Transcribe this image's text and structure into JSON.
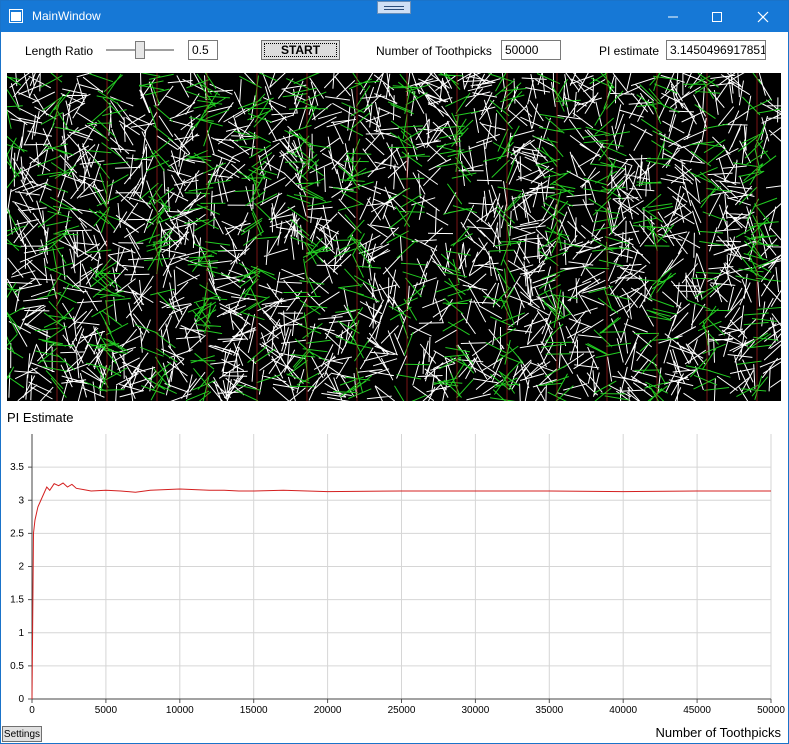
{
  "window": {
    "title": "MainWindow",
    "title_bar_color": "#1678d6"
  },
  "controls": {
    "length_ratio_label": "Length Ratio",
    "length_ratio_value": "0.5",
    "length_ratio_slider_fraction": 0.5,
    "start_label": "START",
    "toothpicks_label": "Number of Toothpicks",
    "toothpicks_value": "50000",
    "pi_label": "PI estimate",
    "pi_value": "3.14504969178513"
  },
  "simulation": {
    "background": "#000000",
    "crossing_color": "#22cc22",
    "non_crossing_color": "#ffffff",
    "line_color": "#cc2222"
  },
  "chart_title": "PI Estimate",
  "settings_label": "Settings",
  "chart_data": {
    "type": "line",
    "title": "PI Estimate",
    "xlabel": "Number of Toothpicks",
    "ylabel": "",
    "xlim": [
      0,
      50000
    ],
    "ylim": [
      0,
      4
    ],
    "xticks": [
      0,
      5000,
      10000,
      15000,
      20000,
      25000,
      30000,
      35000,
      40000,
      45000,
      50000
    ],
    "yticks": [
      0,
      0.5,
      1,
      1.5,
      2,
      2.5,
      3,
      3.5
    ],
    "grid": true,
    "series_color": "#d42020",
    "series": [
      {
        "x": [
          0,
          100,
          200,
          400,
          600,
          800,
          1000,
          1200,
          1500,
          1800,
          2100,
          2400,
          2700,
          3000,
          3500,
          4000,
          5000,
          6000,
          7000,
          8000,
          9000,
          10000,
          11000,
          12000,
          13000,
          14000,
          15000,
          17000,
          20000,
          25000,
          30000,
          35000,
          40000,
          45000,
          50000
        ],
        "y": [
          0,
          2.5,
          2.7,
          2.9,
          3.0,
          3.1,
          3.2,
          3.15,
          3.25,
          3.22,
          3.26,
          3.2,
          3.24,
          3.18,
          3.16,
          3.14,
          3.15,
          3.14,
          3.12,
          3.15,
          3.16,
          3.17,
          3.16,
          3.15,
          3.15,
          3.14,
          3.14,
          3.15,
          3.13,
          3.14,
          3.14,
          3.14,
          3.13,
          3.14,
          3.14
        ]
      }
    ]
  }
}
